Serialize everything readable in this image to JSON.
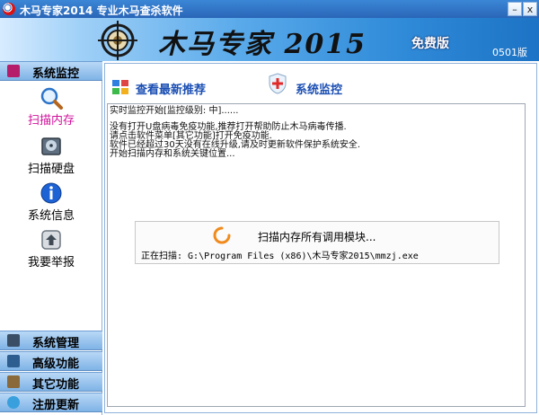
{
  "window": {
    "title": "木马专家2014 专业木马查杀软件",
    "minimize_glyph": "–",
    "close_glyph": "x"
  },
  "banner": {
    "brand": "木马专家 2015",
    "edition": "免费版",
    "version": "0501版"
  },
  "sidebar": {
    "active_section": "系统监控",
    "items": [
      {
        "label": "扫描内存",
        "icon": "magnifier-icon",
        "active": true
      },
      {
        "label": "扫描硬盘",
        "icon": "hard-disk-icon",
        "active": false
      },
      {
        "label": "系统信息",
        "icon": "info-icon",
        "active": false
      },
      {
        "label": "我要举报",
        "icon": "report-upload-icon",
        "active": false
      }
    ],
    "sections": [
      {
        "label": "系统管理",
        "icon": "gear-icon"
      },
      {
        "label": "高级功能",
        "icon": "advanced-gear-icon"
      },
      {
        "label": "其它功能",
        "icon": "tools-icon"
      },
      {
        "label": "注册更新",
        "icon": "globe-icon"
      }
    ]
  },
  "main": {
    "link_recommend": "查看最新推荐",
    "link_monitor": "系统监控",
    "log_lines": [
      "实时监控开始[监控级别: 中]......",
      "",
      "没有打开U盘病毒免疫功能,推荐打开帮助防止木马病毒传播.",
      "请点击软件菜单[其它功能]打开免疫功能.",
      "软件已经超过30天没有在线升级,请及时更新软件保护系统安全.",
      "开始扫描内存和系统关键位置..."
    ],
    "scan_status": "扫描内存所有调用模块...",
    "scan_path": "正在扫描: G:\\Program Files (x86)\\木马专家2015\\mmzj.exe"
  },
  "colors": {
    "title_bar": "#2a66b8",
    "active_item": "#d0109b",
    "link": "#1b4fb3",
    "spinner": "#f08a1c"
  }
}
